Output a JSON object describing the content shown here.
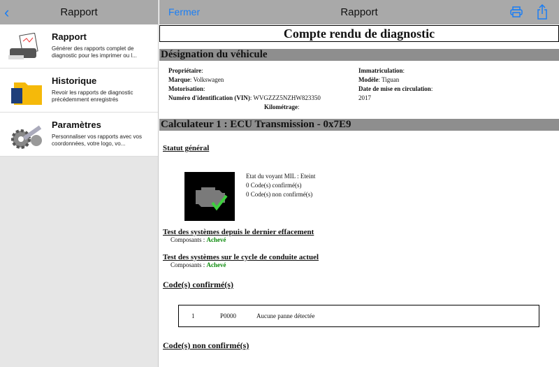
{
  "left": {
    "title": "Rapport",
    "items": [
      {
        "title": "Rapport",
        "desc": "Générer des rapports complet de diagnostic pour les imprimer ou l..."
      },
      {
        "title": "Historique",
        "desc": "Revoir les rapports de diagnostic précédemment enregistrés"
      },
      {
        "title": "Paramètres",
        "desc": "Personnaliser vos rapports avec vos coordonnées, votre logo, vo..."
      }
    ]
  },
  "header": {
    "close": "Fermer",
    "title": "Rapport"
  },
  "doc": {
    "title": "Compte rendu de diagnostic",
    "vehicle_section": "Désignation du véhicule",
    "owner_label": "Propriétaire",
    "owner": "",
    "brand_label": "Marque",
    "brand": "Volkswagen",
    "engine_label": "Motorisation",
    "engine": "",
    "vin_label": "Numéro d'identification (VIN)",
    "vin": "WVGZZZ5NZHW823350",
    "km_label": "Kilométrage",
    "km": "",
    "reg_label": "Immatriculation",
    "reg": "",
    "model_label": "Modèle",
    "model": "Tiguan",
    "date_label": "Date de mise en circulation",
    "date": "2017",
    "ecu_section": "Calculateur 1 : ECU Transmission - 0x7E9",
    "status_title": "Statut général",
    "mil": "Etat du voyant MIL : Eteint",
    "confirmed_count": "0 Code(s) confirmé(s)",
    "unconfirmed_count": "0 Code(s) non confirmé(s)",
    "test1_title": "Test des systèmes depuis le dernier effacement",
    "test1_label": "Composants : ",
    "test1_value": "Achevé",
    "test2_title": "Test des systèmes sur le cycle de conduite actuel",
    "test2_label": "Composants : ",
    "test2_value": "Achevé",
    "confirmed_title": "Code(s) confirmé(s)",
    "codes": [
      {
        "n": "1",
        "code": "P0000",
        "desc": "Aucune panne détectée"
      }
    ],
    "unconfirmed_title": "Code(s) non confirmé(s)"
  }
}
